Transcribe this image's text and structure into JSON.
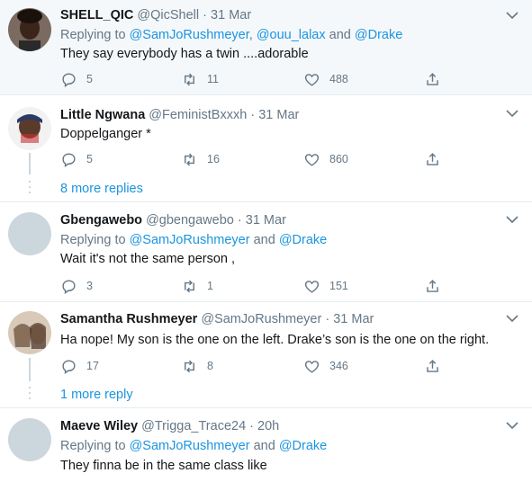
{
  "tweets": [
    {
      "name": "SHELL_QIC",
      "handle": "@QicShell",
      "dot": "·",
      "time": "31 Mar",
      "reply_prefix": "Replying to",
      "reply_links": [
        "@SamJoRushmeyer",
        "@ouu_lalax",
        "@Drake"
      ],
      "reply_sep1": ", ",
      "reply_sep2": " and ",
      "text": "They say everybody has a twin ....adorable",
      "replies": "5",
      "retweets": "11",
      "likes": "488"
    },
    {
      "name": "Little Ngwana",
      "handle": "@FeministBxxxh",
      "dot": "·",
      "time": "31 Mar",
      "text": "Doppelganger *",
      "replies": "5",
      "retweets": "16",
      "likes": "860"
    },
    {
      "name": "Gbengawebo",
      "handle": "@gbengawebo",
      "dot": "·",
      "time": "31 Mar",
      "reply_prefix": "Replying to",
      "reply_links": [
        "@SamJoRushmeyer",
        "@Drake"
      ],
      "reply_sep": " and ",
      "text": "Wait it's not the same person ,",
      "replies": "3",
      "retweets": "1",
      "likes": "151"
    },
    {
      "name": "Samantha Rushmeyer",
      "handle": "@SamJoRushmeyer",
      "dot": "·",
      "time": "31 Mar",
      "text": "Ha nope! My son is the one on the left. Drake’s son is the one on the right.",
      "replies": "17",
      "retweets": "8",
      "likes": "346"
    },
    {
      "name": "Maeve Wiley",
      "handle": "@Trigga_Trace24",
      "dot": "·",
      "time": "20h",
      "reply_prefix": "Replying to",
      "reply_links": [
        "@SamJoRushmeyer",
        "@Drake"
      ],
      "reply_sep": " and ",
      "text": "They finna be in the same class like"
    }
  ],
  "more_replies": [
    "8 more replies",
    "1 more reply"
  ],
  "icons": {
    "reply": "reply-icon",
    "retweet": "retweet-icon",
    "like": "heart-icon",
    "share": "share-icon",
    "caret": "chevron-down-icon"
  },
  "colors": {
    "link": "#1b95e0",
    "secondary": "#657786",
    "highlight_bg": "#f5f8fa",
    "border": "#e6ecf0"
  }
}
